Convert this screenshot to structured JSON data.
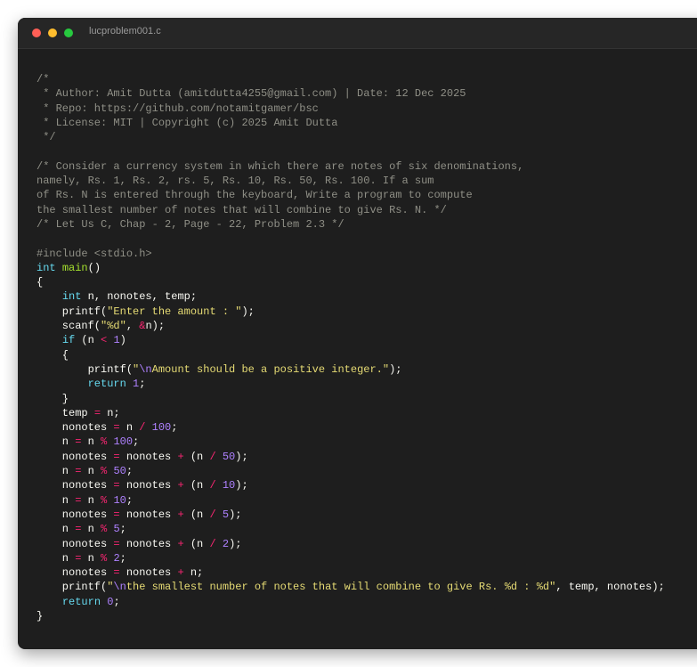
{
  "window": {
    "title": "lucproblem001.c",
    "controls": [
      "close",
      "minimize",
      "maximize"
    ]
  },
  "colors": {
    "comment": "#8f8f86",
    "keyword": "#66d9ef",
    "function": "#a6e22e",
    "string": "#e6db74",
    "number": "#ae81ff",
    "operator": "#f92672",
    "plain": "#f8f8f2",
    "background": "#1e1e1e"
  },
  "code": {
    "lines": [
      [
        [
          "comment",
          "/*"
        ]
      ],
      [
        [
          "comment",
          " * Author: Amit Dutta (amitdutta4255@gmail.com) | Date: 12 Dec 2025"
        ]
      ],
      [
        [
          "comment",
          " * Repo: https://github.com/notamitgamer/bsc"
        ]
      ],
      [
        [
          "comment",
          " * License: MIT | Copyright (c) 2025 Amit Dutta"
        ]
      ],
      [
        [
          "comment",
          " */"
        ]
      ],
      [],
      [
        [
          "comment",
          "/* Consider a currency system in which there are notes of six denominations,"
        ]
      ],
      [
        [
          "comment",
          "namely, Rs. 1, Rs. 2, rs. 5, Rs. 10, Rs. 50, Rs. 100. If a sum"
        ]
      ],
      [
        [
          "comment",
          "of Rs. N is entered through the keyboard, Write a program to compute"
        ]
      ],
      [
        [
          "comment",
          "the smallest number of notes that will combine to give Rs. N. */"
        ]
      ],
      [
        [
          "comment",
          "/* Let Us C, Chap - 2, Page - 22, Problem 2.3 */"
        ]
      ],
      [],
      [
        [
          "preproc",
          "#include <stdio.h>"
        ]
      ],
      [
        [
          "keyword",
          "int"
        ],
        [
          "plain",
          " "
        ],
        [
          "func",
          "main"
        ],
        [
          "plain",
          "()"
        ]
      ],
      [
        [
          "plain",
          "{"
        ]
      ],
      [
        [
          "plain",
          "    "
        ],
        [
          "keyword",
          "int"
        ],
        [
          "plain",
          " n, nonotes, temp;"
        ]
      ],
      [
        [
          "plain",
          "    printf("
        ],
        [
          "string",
          "\"Enter the amount : \""
        ],
        [
          "plain",
          ");"
        ]
      ],
      [
        [
          "plain",
          "    scanf("
        ],
        [
          "string",
          "\"%d\""
        ],
        [
          "plain",
          ", "
        ],
        [
          "op",
          "&"
        ],
        [
          "plain",
          "n);"
        ]
      ],
      [
        [
          "plain",
          "    "
        ],
        [
          "keyword",
          "if"
        ],
        [
          "plain",
          " (n "
        ],
        [
          "op",
          "<"
        ],
        [
          "plain",
          " "
        ],
        [
          "number",
          "1"
        ],
        [
          "plain",
          ")"
        ]
      ],
      [
        [
          "plain",
          "    {"
        ]
      ],
      [
        [
          "plain",
          "        printf("
        ],
        [
          "string",
          "\""
        ],
        [
          "escape",
          "\\n"
        ],
        [
          "string",
          "Amount should be a positive integer.\""
        ],
        [
          "plain",
          ");"
        ]
      ],
      [
        [
          "plain",
          "        "
        ],
        [
          "keyword",
          "return"
        ],
        [
          "plain",
          " "
        ],
        [
          "number",
          "1"
        ],
        [
          "plain",
          ";"
        ]
      ],
      [
        [
          "plain",
          "    }"
        ]
      ],
      [
        [
          "plain",
          "    temp "
        ],
        [
          "op",
          "="
        ],
        [
          "plain",
          " n;"
        ]
      ],
      [
        [
          "plain",
          "    nonotes "
        ],
        [
          "op",
          "="
        ],
        [
          "plain",
          " n "
        ],
        [
          "op",
          "/"
        ],
        [
          "plain",
          " "
        ],
        [
          "number",
          "100"
        ],
        [
          "plain",
          ";"
        ]
      ],
      [
        [
          "plain",
          "    n "
        ],
        [
          "op",
          "="
        ],
        [
          "plain",
          " n "
        ],
        [
          "op",
          "%"
        ],
        [
          "plain",
          " "
        ],
        [
          "number",
          "100"
        ],
        [
          "plain",
          ";"
        ]
      ],
      [
        [
          "plain",
          "    nonotes "
        ],
        [
          "op",
          "="
        ],
        [
          "plain",
          " nonotes "
        ],
        [
          "op",
          "+"
        ],
        [
          "plain",
          " (n "
        ],
        [
          "op",
          "/"
        ],
        [
          "plain",
          " "
        ],
        [
          "number",
          "50"
        ],
        [
          "plain",
          ");"
        ]
      ],
      [
        [
          "plain",
          "    n "
        ],
        [
          "op",
          "="
        ],
        [
          "plain",
          " n "
        ],
        [
          "op",
          "%"
        ],
        [
          "plain",
          " "
        ],
        [
          "number",
          "50"
        ],
        [
          "plain",
          ";"
        ]
      ],
      [
        [
          "plain",
          "    nonotes "
        ],
        [
          "op",
          "="
        ],
        [
          "plain",
          " nonotes "
        ],
        [
          "op",
          "+"
        ],
        [
          "plain",
          " (n "
        ],
        [
          "op",
          "/"
        ],
        [
          "plain",
          " "
        ],
        [
          "number",
          "10"
        ],
        [
          "plain",
          ");"
        ]
      ],
      [
        [
          "plain",
          "    n "
        ],
        [
          "op",
          "="
        ],
        [
          "plain",
          " n "
        ],
        [
          "op",
          "%"
        ],
        [
          "plain",
          " "
        ],
        [
          "number",
          "10"
        ],
        [
          "plain",
          ";"
        ]
      ],
      [
        [
          "plain",
          "    nonotes "
        ],
        [
          "op",
          "="
        ],
        [
          "plain",
          " nonotes "
        ],
        [
          "op",
          "+"
        ],
        [
          "plain",
          " (n "
        ],
        [
          "op",
          "/"
        ],
        [
          "plain",
          " "
        ],
        [
          "number",
          "5"
        ],
        [
          "plain",
          ");"
        ]
      ],
      [
        [
          "plain",
          "    n "
        ],
        [
          "op",
          "="
        ],
        [
          "plain",
          " n "
        ],
        [
          "op",
          "%"
        ],
        [
          "plain",
          " "
        ],
        [
          "number",
          "5"
        ],
        [
          "plain",
          ";"
        ]
      ],
      [
        [
          "plain",
          "    nonotes "
        ],
        [
          "op",
          "="
        ],
        [
          "plain",
          " nonotes "
        ],
        [
          "op",
          "+"
        ],
        [
          "plain",
          " (n "
        ],
        [
          "op",
          "/"
        ],
        [
          "plain",
          " "
        ],
        [
          "number",
          "2"
        ],
        [
          "plain",
          ");"
        ]
      ],
      [
        [
          "plain",
          "    n "
        ],
        [
          "op",
          "="
        ],
        [
          "plain",
          " n "
        ],
        [
          "op",
          "%"
        ],
        [
          "plain",
          " "
        ],
        [
          "number",
          "2"
        ],
        [
          "plain",
          ";"
        ]
      ],
      [
        [
          "plain",
          "    nonotes "
        ],
        [
          "op",
          "="
        ],
        [
          "plain",
          " nonotes "
        ],
        [
          "op",
          "+"
        ],
        [
          "plain",
          " n;"
        ]
      ],
      [
        [
          "plain",
          "    printf("
        ],
        [
          "string",
          "\""
        ],
        [
          "escape",
          "\\n"
        ],
        [
          "string",
          "the smallest number of notes that will combine to give Rs. %d : %d\""
        ],
        [
          "plain",
          ", temp, nonotes);"
        ]
      ],
      [
        [
          "plain",
          "    "
        ],
        [
          "keyword",
          "return"
        ],
        [
          "plain",
          " "
        ],
        [
          "number",
          "0"
        ],
        [
          "plain",
          ";"
        ]
      ],
      [
        [
          "plain",
          "}"
        ]
      ]
    ]
  }
}
